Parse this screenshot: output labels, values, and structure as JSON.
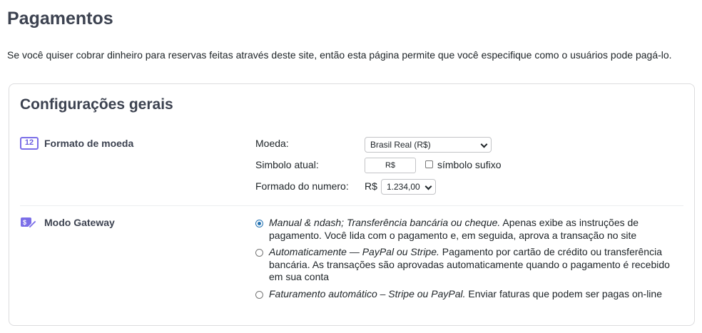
{
  "page": {
    "title": "Pagamentos",
    "intro": "Se você quiser cobrar dinheiro para reservas feitas através deste site, então esta página permite que você especifique como o usuários pode pagá-lo."
  },
  "general": {
    "title": "Configurações gerais",
    "currency_format": {
      "label": "Formato de moeda",
      "icon_text": "12",
      "currency_label": "Moeda:",
      "currency_value": "Brasil Real (R$)",
      "symbol_label": "Simbolo atual:",
      "symbol_value": "R$",
      "suffix_label": "símbolo sufixo",
      "suffix_checked": false,
      "number_format_label": "Formado do numero:",
      "number_prefix": "R$",
      "number_format_value": "1.234,00"
    },
    "gateway": {
      "label": "Modo Gateway",
      "options": [
        {
          "title": "Manual & ndash; Transferência bancária ou cheque.",
          "description": "Apenas exibe as instruções de pagamento. Você lida com o pagamento e, em seguida, aprova a transação no site",
          "checked": true
        },
        {
          "title": "Automaticamente — PayPal ou Stripe.",
          "description": "Pagamento por cartão de crédito ou transferência bancária. As transações são aprovadas automaticamente quando o pagamento é recebido em sua conta",
          "checked": false
        },
        {
          "title": "Faturamento automático – Stripe ou PayPal.",
          "description": "Enviar faturas que podem ser pagas on-line",
          "checked": false
        }
      ]
    }
  },
  "colors": {
    "accent": "#7b6ee8",
    "radio_checked": "#2271b1",
    "heading": "#3c4250"
  }
}
